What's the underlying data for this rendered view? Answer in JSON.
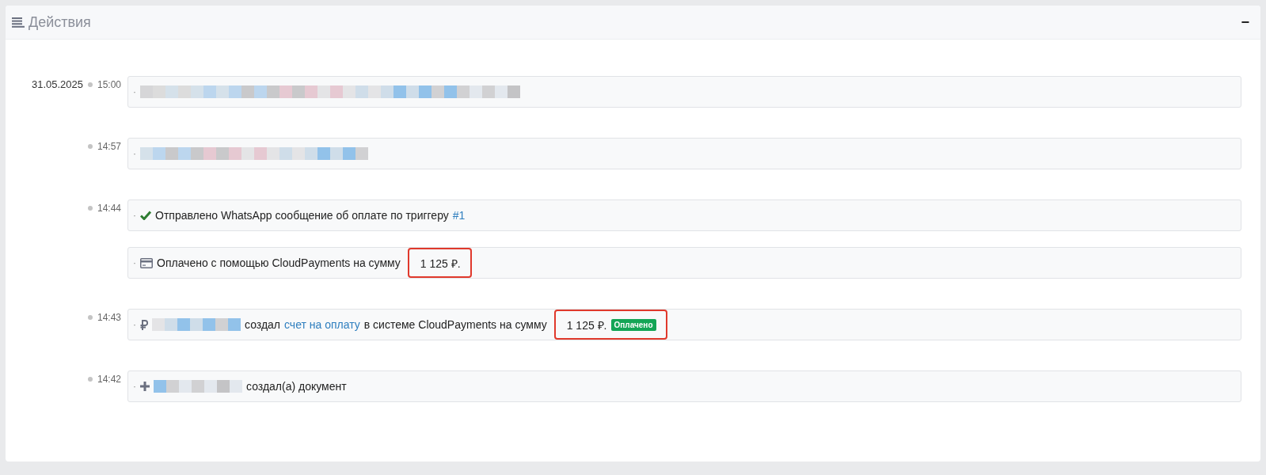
{
  "panel": {
    "title": "Действия",
    "collapse_control": "−"
  },
  "entries": [
    {
      "date": "31.05.2025",
      "time": "15:00",
      "lines": [
        {
          "bullet": "·",
          "kind": "plain",
          "segments": [
            {
              "kind": "redacted"
            }
          ]
        }
      ]
    },
    {
      "time": "14:57",
      "lines": [
        {
          "bullet": "·",
          "kind": "plain",
          "segments": [
            {
              "kind": "redacted"
            }
          ]
        }
      ]
    },
    {
      "time": "14:44",
      "lines": [
        {
          "bullet": "·",
          "kind": "check",
          "segments": [
            {
              "kind": "text",
              "text": "Отправлено WhatsApp сообщение об оплате по триггеру"
            },
            {
              "kind": "link",
              "text": "#1"
            }
          ]
        },
        {
          "bullet": "·",
          "kind": "card",
          "segments": [
            {
              "kind": "text",
              "text": "Оплачено с помощью CloudPayments на сумму"
            },
            {
              "kind": "amount",
              "text": "1 125 ₽.",
              "highlighted": true
            }
          ]
        }
      ]
    },
    {
      "time": "14:43",
      "lines": [
        {
          "bullet": "·",
          "kind": "ruble",
          "segments": [
            {
              "kind": "redacted"
            },
            {
              "kind": "text",
              "text": "создал"
            },
            {
              "kind": "link",
              "text": "счет на оплату"
            },
            {
              "kind": "text",
              "text": "в системе CloudPayments на сумму"
            },
            {
              "kind": "amount",
              "text": "1 125 ₽.",
              "badge": "Оплачено",
              "highlighted": true
            }
          ]
        }
      ]
    },
    {
      "time": "14:42",
      "lines": [
        {
          "bullet": "·",
          "kind": "plus",
          "segments": [
            {
              "kind": "redacted"
            },
            {
              "kind": "text",
              "text": "создал(а) документ"
            }
          ]
        }
      ]
    }
  ]
}
